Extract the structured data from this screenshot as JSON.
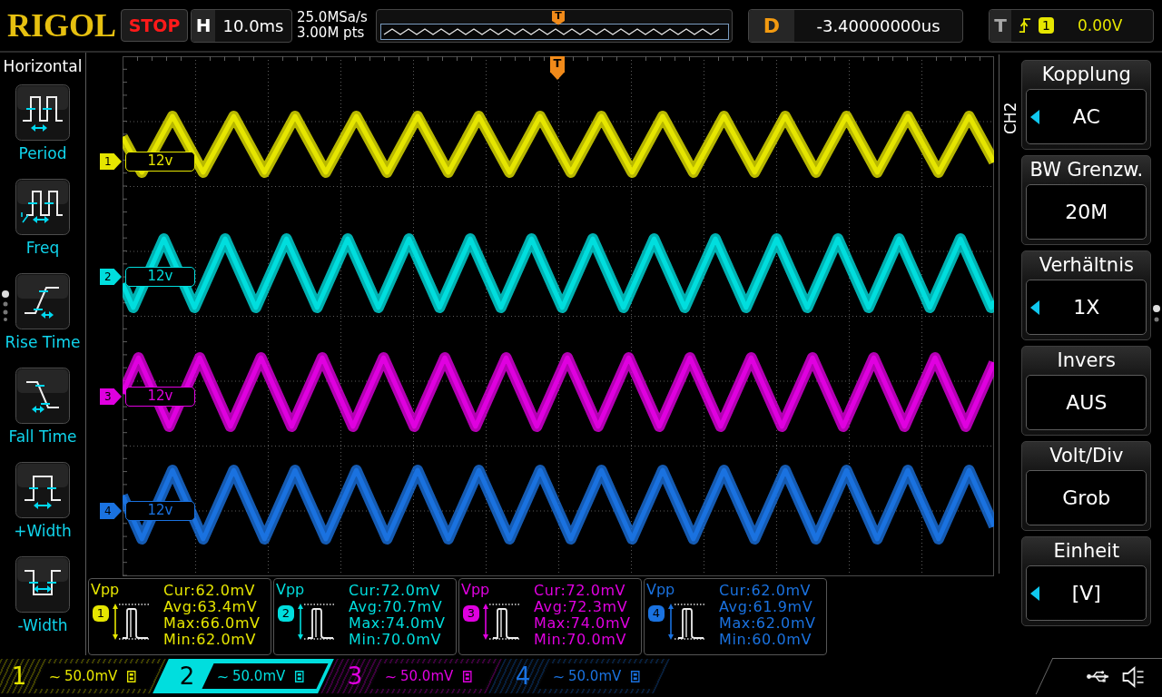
{
  "header": {
    "logo": "RIGOL",
    "run_state": "STOP",
    "timebase": {
      "label": "H",
      "value": "10.0ms"
    },
    "sample_rate": "25.0MSa/s",
    "memory_depth": "3.00M pts",
    "overview": {
      "trigger_marker": "T"
    },
    "delay": {
      "label": "D",
      "value": "-3.40000000us"
    },
    "trigger": {
      "label": "T",
      "rising_edge": true,
      "source": "1",
      "level": "0.00V"
    }
  },
  "sidebar": {
    "title": "Horizontal",
    "items": [
      {
        "kind": "period",
        "label": "Period"
      },
      {
        "kind": "freq",
        "label": "Freq"
      },
      {
        "kind": "rise",
        "label": "Rise Time"
      },
      {
        "kind": "fall",
        "label": "Fall Time"
      },
      {
        "kind": "pos_width",
        "label": "+Width"
      },
      {
        "kind": "neg_width",
        "label": "-Width"
      }
    ]
  },
  "waveform": {
    "trigger_marker": "T",
    "channels": [
      {
        "number": "1",
        "label": "12v",
        "color": "#e6e600"
      },
      {
        "number": "2",
        "label": "12v",
        "color": "#00dede"
      },
      {
        "number": "3",
        "label": "12v",
        "color": "#e000e0"
      },
      {
        "number": "4",
        "label": "12v",
        "color": "#1a72e0"
      }
    ]
  },
  "measurements": [
    {
      "type": "Vpp",
      "channel": "1",
      "readings": [
        "Cur:62.0mV",
        "Avg:63.4mV",
        "Max:66.0mV",
        "Min:62.0mV"
      ]
    },
    {
      "type": "Vpp",
      "channel": "2",
      "readings": [
        "Cur:72.0mV",
        "Avg:70.7mV",
        "Max:74.0mV",
        "Min:70.0mV"
      ]
    },
    {
      "type": "Vpp",
      "channel": "3",
      "readings": [
        "Cur:72.0mV",
        "Avg:72.3mV",
        "Max:74.0mV",
        "Min:70.0mV"
      ]
    },
    {
      "type": "Vpp",
      "channel": "4",
      "readings": [
        "Cur:62.0mV",
        "Avg:61.9mV",
        "Max:62.0mV",
        "Min:60.0mV"
      ]
    }
  ],
  "menu": {
    "title": "CH2",
    "items": [
      {
        "label": "Kopplung",
        "value": "AC",
        "selectable": true
      },
      {
        "label": "BW Grenzw.",
        "value": "20M",
        "selectable": false
      },
      {
        "label": "Verhältnis",
        "value": "1X",
        "selectable": true
      },
      {
        "label": "Invers",
        "value": "AUS",
        "selectable": false
      },
      {
        "label": "Volt/Div",
        "value": "Grob",
        "selectable": false
      },
      {
        "label": "Einheit",
        "value": "[V]",
        "selectable": true
      }
    ]
  },
  "status_bar": {
    "channels": [
      {
        "number": "1",
        "coupling": "~",
        "scale": "50.0mV",
        "bw_limit": true,
        "selected": false
      },
      {
        "number": "2",
        "coupling": "~",
        "scale": "50.0mV",
        "bw_limit": true,
        "selected": true
      },
      {
        "number": "3",
        "coupling": "~",
        "scale": "50.0mV",
        "bw_limit": true,
        "selected": false
      },
      {
        "number": "4",
        "coupling": "~",
        "scale": "50.0mV",
        "bw_limit": true,
        "selected": false
      }
    ]
  }
}
